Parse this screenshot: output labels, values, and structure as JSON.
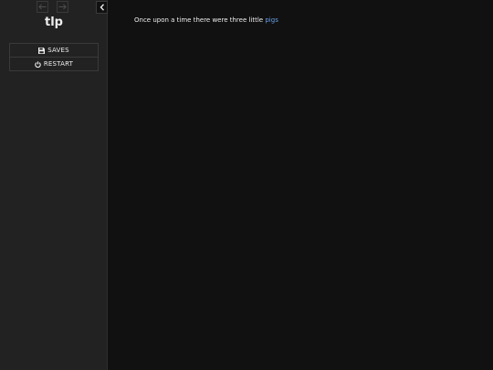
{
  "sidebar": {
    "history": {
      "back_icon": "arrow-left-icon",
      "forward_icon": "arrow-right-icon"
    },
    "toggle_icon": "chevron-left-icon",
    "story_title": "tlp",
    "menu": {
      "saves": {
        "label": "SAVES",
        "icon": "floppy-disk-icon"
      },
      "restart": {
        "label": "RESTART",
        "icon": "power-icon"
      }
    }
  },
  "passage": {
    "text": "Once upon a time there were three little",
    "link": "pigs"
  },
  "colors": {
    "background": "#111111",
    "sidebar": "#222222",
    "text": "#eeeeee",
    "link": "#68a0e8"
  }
}
